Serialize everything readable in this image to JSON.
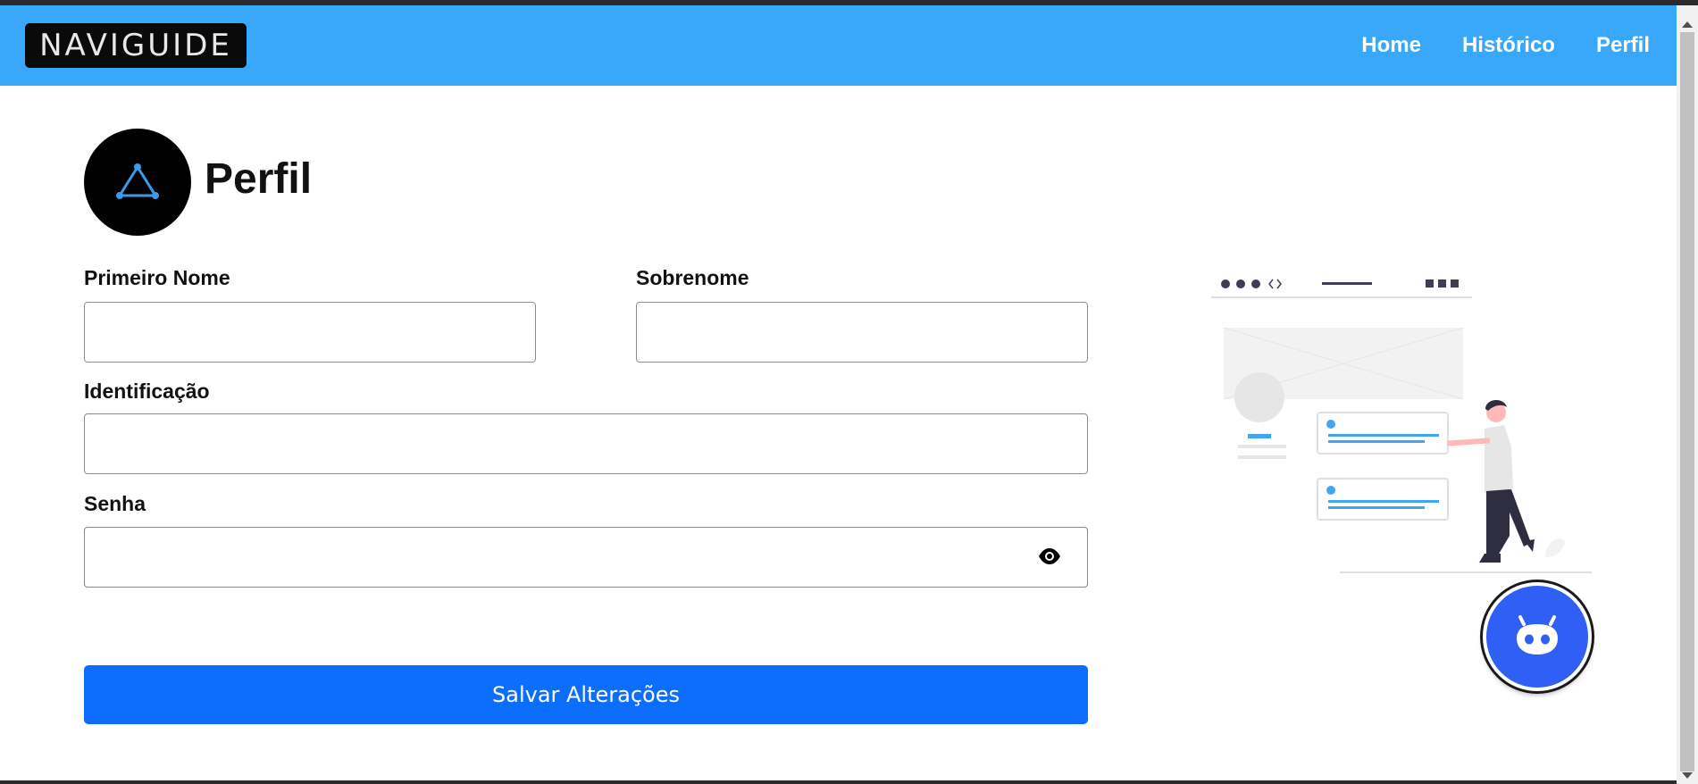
{
  "header": {
    "logo_text": "NAVIGUIDE",
    "nav": [
      {
        "label": "Home"
      },
      {
        "label": "Histórico"
      },
      {
        "label": "Perfil"
      }
    ]
  },
  "profile": {
    "title": "Perfil"
  },
  "form": {
    "first_name": {
      "label": "Primeiro Nome",
      "value": ""
    },
    "last_name": {
      "label": "Sobrenome",
      "value": ""
    },
    "identification": {
      "label": "Identificação",
      "value": ""
    },
    "password": {
      "label": "Senha",
      "value": ""
    },
    "save_label": "Salvar Alterações"
  },
  "colors": {
    "navbar": "#39a8fb",
    "primary_button": "#0d6efd",
    "chatbot": "#2f5ff5",
    "illustration_accent": "#3ea6f5"
  },
  "icons": {
    "password_toggle": "eye-icon",
    "chatbot": "robot-icon",
    "avatar": "triangle-network-icon"
  }
}
